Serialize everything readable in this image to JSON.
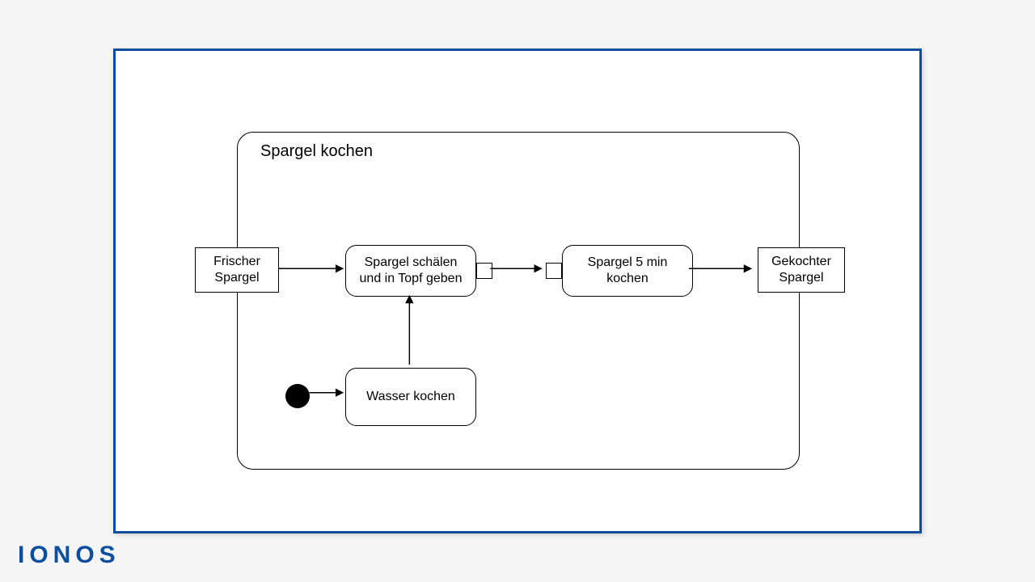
{
  "diagram": {
    "container_title": "Spargel kochen",
    "nodes": {
      "input_object": "Frischer\nSpargel",
      "action_peel": "Spargel schälen\nund in Topf geben",
      "action_cook": "Spargel 5 min\nkochen",
      "output_object": "Gekochter\nSpargel",
      "action_boil_water": "Wasser kochen"
    }
  },
  "branding": {
    "logo_text": "IONOS"
  }
}
